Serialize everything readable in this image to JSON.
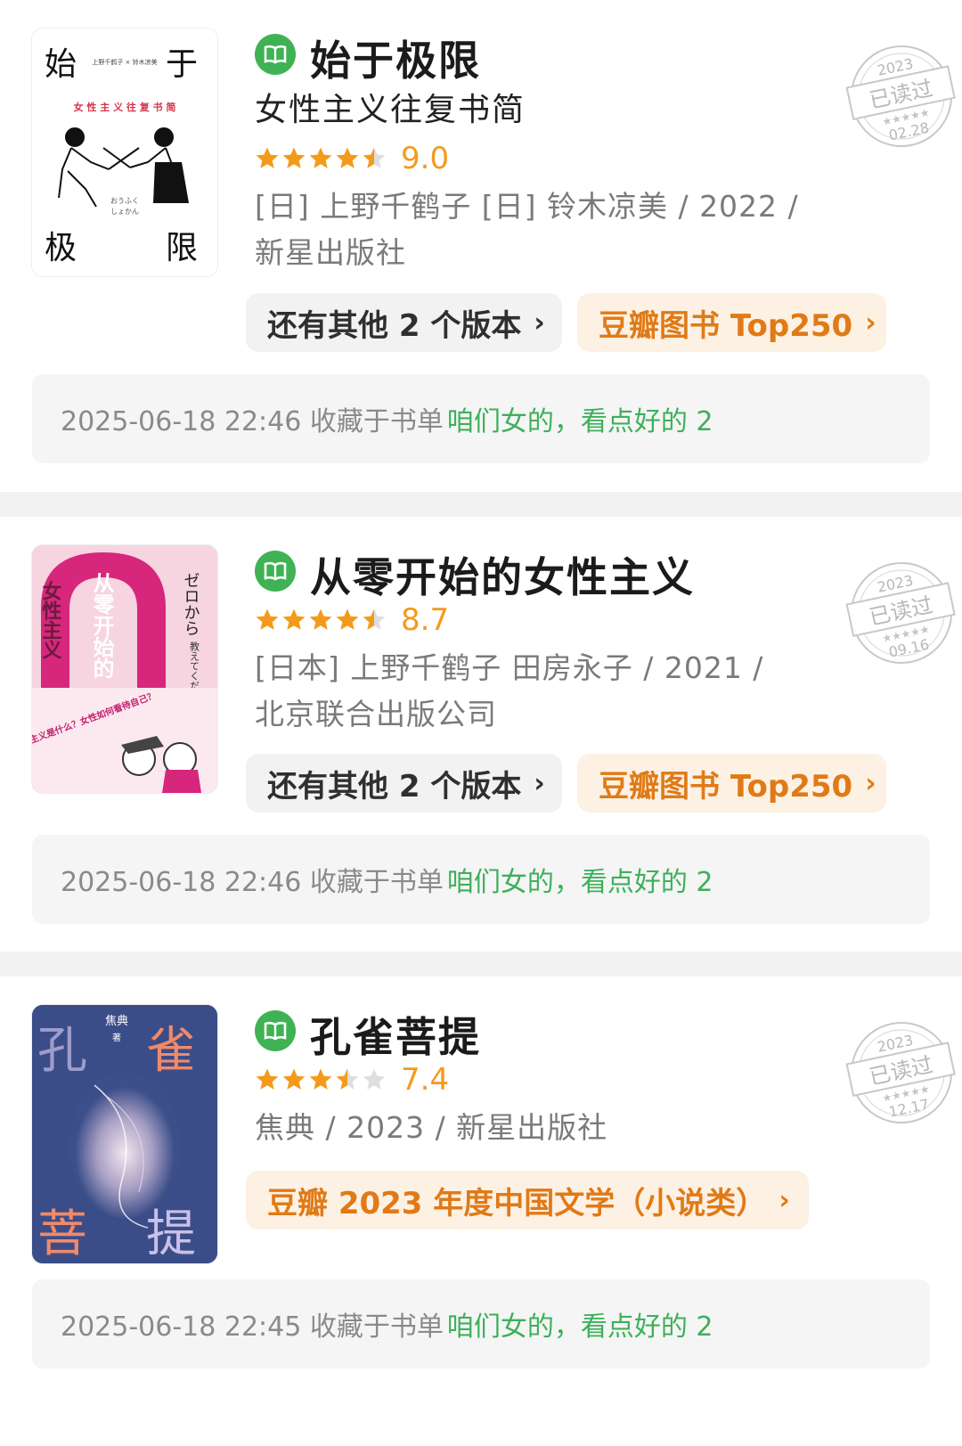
{
  "books": [
    {
      "title": "始于极限",
      "subtitle": "女性主义往复书简",
      "score": "9.0",
      "rating_stars": 4.5,
      "meta": "[日] 上野千鹤子 [日] 铃木凉美 / 2022 / 新星出版社",
      "chips": [
        {
          "label": "还有其他 2 个版本",
          "style": "gray"
        },
        {
          "label": "豆瓣图书 Top250",
          "style": "orange"
        }
      ],
      "note_time": "2025-06-18 22:46 收藏于书单",
      "note_list": "咱们女的，看点好的 2",
      "stamp": {
        "year": "2023",
        "text": "已读过",
        "date": "02.28"
      },
      "cover": {
        "top_left": "始",
        "top_right": "于",
        "bottom_left": "极",
        "bottom_right": "限",
        "authors": "上野千鹤子 × 铃木凉美",
        "tagline": "女 性 主 义 往 复 书 简",
        "kana1": "おうふく",
        "kana2": "しょかん"
      }
    },
    {
      "title": "从零开始的女性主义",
      "score": "8.7",
      "rating_stars": 4.5,
      "meta": "[日本] 上野千鹤子 田房永子 / 2021 / 北京联合出版公司",
      "chips": [
        {
          "label": "还有其他 2 个版本",
          "style": "gray"
        },
        {
          "label": "豆瓣图书 Top250",
          "style": "orange"
        }
      ],
      "note_time": "2025-06-18 22:46 收藏于书单",
      "note_list": "咱们女的，看点好的 2",
      "stamp": {
        "year": "2023",
        "text": "已读过",
        "date": "09.16"
      },
      "cover": {
        "title_col1": "从零开始的",
        "title_col2": "女性主义",
        "jp": "ゼロから",
        "jp2": "教えてください！",
        "blurb": "女性主义是什么？女性如何看待自己？"
      }
    },
    {
      "title": "孔雀菩提",
      "score": "7.4",
      "rating_stars": 3.5,
      "meta": "焦典 / 2023 / 新星出版社",
      "chips": [
        {
          "label": "豆瓣 2023 年度中国文学（小说类）",
          "style": "orange"
        }
      ],
      "note_time": "2025-06-18 22:45 收藏于书单",
      "note_list": "咱们女的，看点好的 2",
      "stamp": {
        "year": "2023",
        "text": "已读过",
        "date": "12.17"
      },
      "cover": {
        "c1": "孔",
        "c2": "雀",
        "c3": "菩",
        "c4": "提",
        "author": "焦典",
        "author_suffix": "著"
      }
    }
  ],
  "colors": {
    "green": "#3fb254",
    "orange": "#e07a17",
    "star": "#f49a1a"
  }
}
